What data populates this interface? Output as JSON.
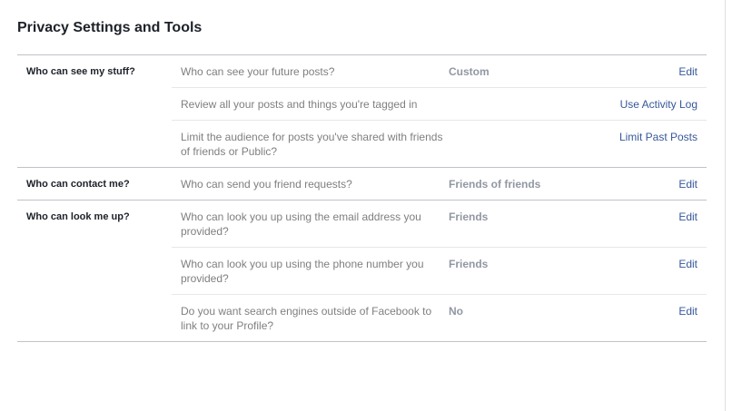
{
  "page": {
    "title": "Privacy Settings and Tools"
  },
  "sections": [
    {
      "label": "Who can see my stuff?",
      "rows": [
        {
          "question": "Who can see your future posts?",
          "value": "Custom",
          "action": "Edit"
        },
        {
          "question": "Review all your posts and things you're tagged in",
          "value": "",
          "action": "Use Activity Log"
        },
        {
          "question": "Limit the audience for posts you've shared with friends of friends or Public?",
          "value": "",
          "action": "Limit Past Posts"
        }
      ]
    },
    {
      "label": "Who can contact me?",
      "rows": [
        {
          "question": "Who can send you friend requests?",
          "value": "Friends of friends",
          "action": "Edit"
        }
      ]
    },
    {
      "label": "Who can look me up?",
      "rows": [
        {
          "question": "Who can look you up using the email address you provided?",
          "value": "Friends",
          "action": "Edit"
        },
        {
          "question": "Who can look you up using the phone number you provided?",
          "value": "Friends",
          "action": "Edit"
        },
        {
          "question": "Do you want search engines outside of Facebook to link to your Profile?",
          "value": "No",
          "action": "Edit"
        }
      ]
    }
  ],
  "colors": {
    "link": "#365899",
    "muted_text": "#7f7f7f",
    "value_text": "#9197a3",
    "heading_text": "#1d2129",
    "divider": "#bfc2c7"
  }
}
